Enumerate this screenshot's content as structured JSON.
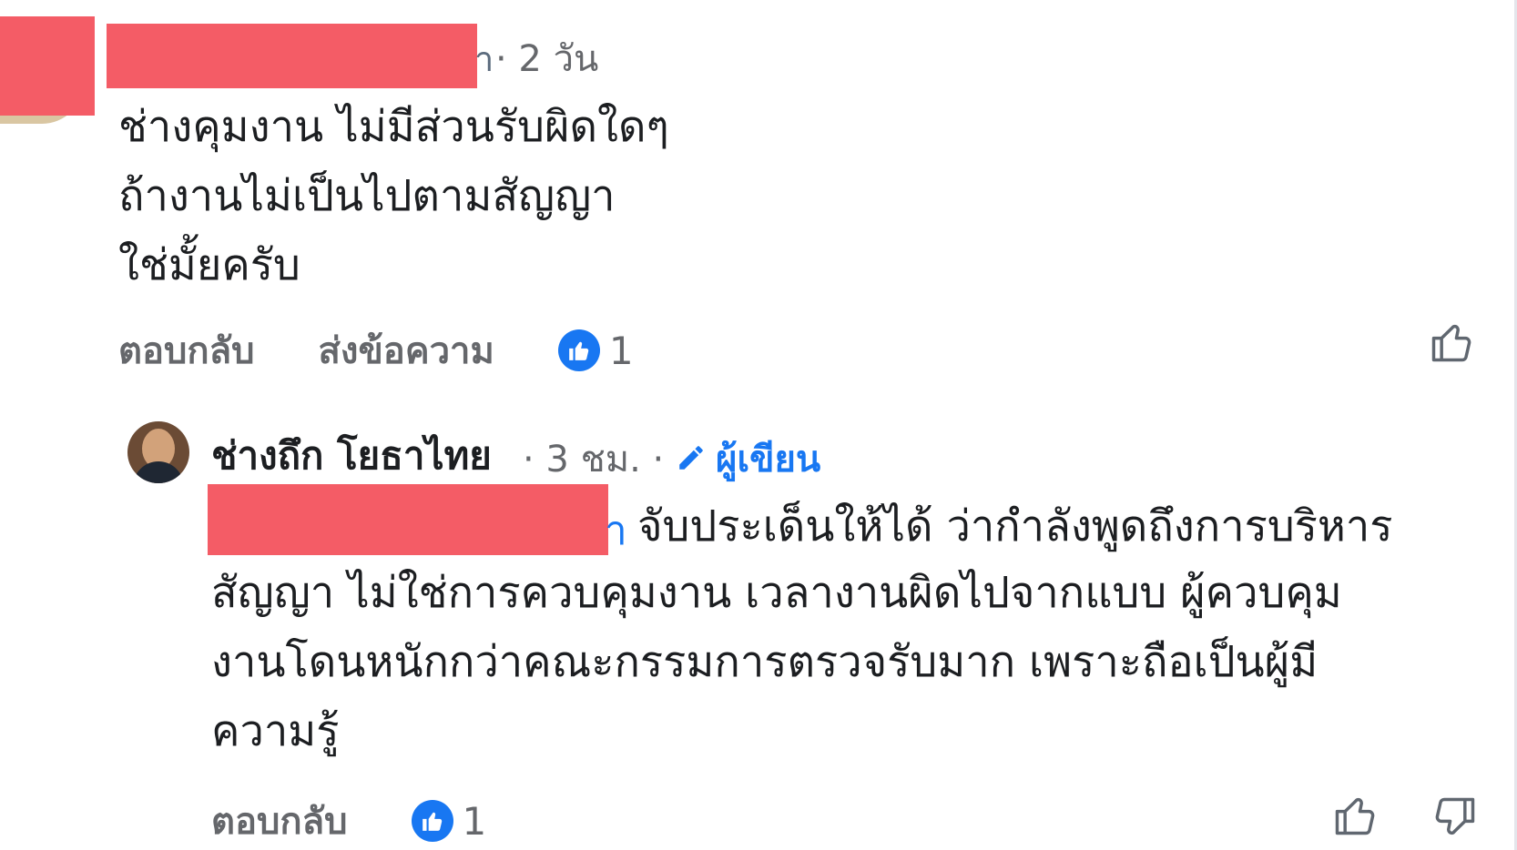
{
  "comment_top": {
    "author_tail": "า",
    "meta": "· 2 วัน",
    "text": "ช่างคุมงาน ไม่มีส่วนรับผิดใดๆ\nถ้างานไม่เป็นไปตามสัญญา\nใช่มั้ยครับ",
    "actions": {
      "reply_label": "ตอบกลับ",
      "message_label": "ส่งข้อความ",
      "reaction_count": "1"
    }
  },
  "reply": {
    "author": "ช่างถึก โยธาไทย",
    "meta": "· 3 ชม. ·",
    "author_badge": "ผู้เขียน",
    "mention_tail": "า",
    "text_line_1": "จับประเด็นให้ได้ ว่ากำลังพูดถึงการบริหาร",
    "text_rest": "สัญญา ไม่ใช่การควบคุมงาน เวลางานผิดไปจากแบบ ผู้ควบคุม\nงานโดนหนักกว่าคณะกรรมการตรวจรับมาก เพราะถือเป็นผู้มี\nความรู้",
    "actions": {
      "reply_label": "ตอบกลับ",
      "reaction_count": "1"
    }
  },
  "icons": {
    "like_badge": "like-badge-icon",
    "thumb_up": "thumb-up-icon",
    "thumb_down": "thumb-down-icon",
    "edit": "pencil-icon"
  },
  "colors": {
    "accent": "#1877f2",
    "secondary_text": "#65676b",
    "redaction": "#f45c66"
  }
}
